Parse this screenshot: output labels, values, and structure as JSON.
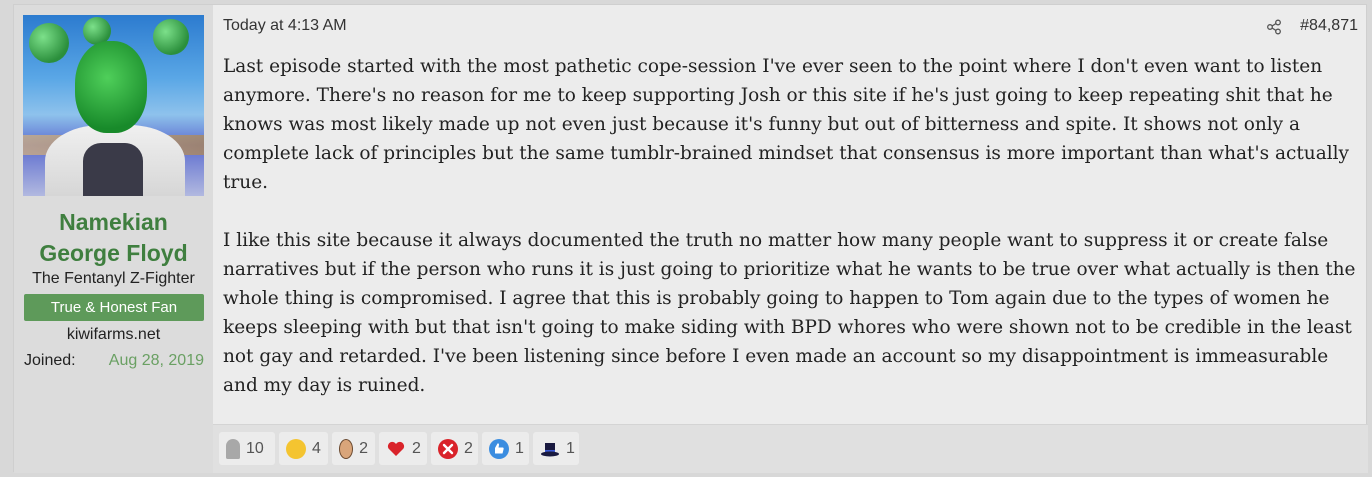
{
  "user": {
    "name_line1": "Namekian",
    "name_line2": "George Floyd",
    "title": "The Fentanyl Z-Fighter",
    "banner": "True & Honest Fan",
    "site": "kiwifarms.net",
    "joined_label": "Joined:",
    "joined_value": "Aug 28, 2019"
  },
  "post": {
    "timestamp": "Today at 4:13 AM",
    "number": "#84,871",
    "paragraphs": [
      "Last episode started with the most pathetic cope-session I've ever seen to the point where I don't even want to listen anymore. There's no reason for me to keep supporting Josh or this site if he's just going to keep repeating shit that he knows was most likely made up not even just because it's funny but out of bitterness and spite. It shows not only a complete lack of principles but the same tumblr-brained mindset that consensus is more important than what's actually true.",
      "I like this site because it always documented the truth no matter how many people want to suppress it or create false narratives but if the person who runs it is just going to prioritize what he wants to be true over what actually is then the whole thing is compromised. I agree that this is probably going to happen to Tom again due to the types of women he keeps sleeping with but that isn't going to make siding with BPD whores who were shown not to be credible in the least not gay and retarded. I've been listening since before I even made an account so my disappointment is immeasurable and my day is ruined."
    ]
  },
  "reactions": [
    {
      "icon": "tombstone-icon",
      "count": "10",
      "color": "#a0a0a0"
    },
    {
      "icon": "thinking-icon",
      "count": "4",
      "color": "#f4c430"
    },
    {
      "icon": "face-icon",
      "count": "2",
      "color": "#d9a57a"
    },
    {
      "icon": "heart-icon",
      "count": "2",
      "color": "#d9232a"
    },
    {
      "icon": "x-icon",
      "count": "2",
      "color": "#d9232a"
    },
    {
      "icon": "thumbs-up-icon",
      "count": "1",
      "color": "#3b8de0"
    },
    {
      "icon": "top-hat-icon",
      "count": "1",
      "color": "#1a1a40"
    }
  ]
}
